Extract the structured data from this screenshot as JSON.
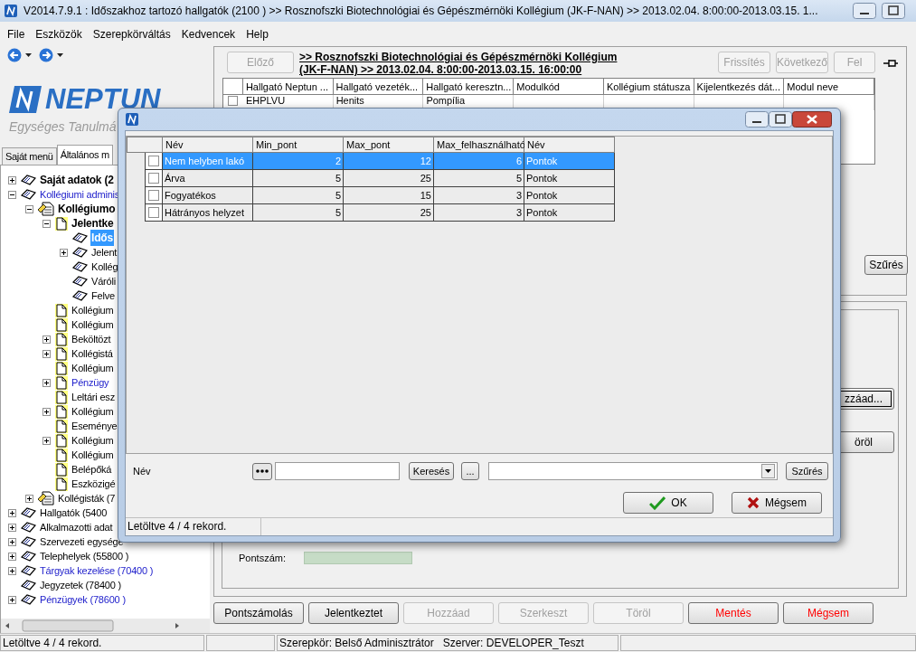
{
  "window": {
    "title": "V2014.7.9.1 : Időszakhoz tartozó hallgatók (2100  ) >> Rosznofszki Biotechnológiai és Gépészmérnöki Kollégium (JK-F-NAN) >> 2013.02.04. 8:00:00-2013.03.15. 1..."
  },
  "menu": [
    "File",
    "Eszközök",
    "Szerepkörváltás",
    "Kedvencek",
    "Help"
  ],
  "logo": {
    "name": "NEPTUN",
    "tagline": "Egységes Tanulmá"
  },
  "sidebar_tabs": [
    {
      "label": "Saját menü",
      "selected": false
    },
    {
      "label": "Általános m",
      "selected": true
    }
  ],
  "tree": [
    {
      "label": "Saját adatok (2",
      "kind": "book",
      "bold": true,
      "linked": false,
      "expanded": false,
      "selected": false
    },
    {
      "label": "Kollégiumi adminis",
      "kind": "book",
      "bold": false,
      "linked": true,
      "expanded": true,
      "selected": false,
      "children": [
        {
          "label": "Kollégiumo",
          "kind": "module",
          "bold": true,
          "linked": false,
          "expanded": true,
          "selected": false,
          "children": [
            {
              "label": "Jelentke",
              "kind": "page",
              "bold": true,
              "linked": false,
              "expanded": true,
              "selected": false,
              "children": [
                {
                  "label": "Idős",
                  "kind": "book",
                  "bold": true,
                  "linked": false,
                  "selected": true
                },
                {
                  "label": "Jelent",
                  "kind": "book",
                  "bold": false,
                  "linked": false,
                  "expanded": false,
                  "selected": false
                },
                {
                  "label": "Kollég",
                  "kind": "book",
                  "bold": false,
                  "linked": false,
                  "selected": false
                },
                {
                  "label": "Váróli",
                  "kind": "book",
                  "bold": false,
                  "linked": false,
                  "selected": false
                },
                {
                  "label": "Felve",
                  "kind": "book",
                  "bold": false,
                  "linked": false,
                  "selected": false
                }
              ]
            },
            {
              "label": "Kollégium",
              "kind": "page",
              "bold": false,
              "linked": false,
              "selected": false
            },
            {
              "label": "Kollégium",
              "kind": "page",
              "bold": false,
              "linked": false,
              "selected": false
            },
            {
              "label": "Beköltözt",
              "kind": "page",
              "bold": false,
              "linked": false,
              "expanded": false,
              "selected": false
            },
            {
              "label": "Kollégistá",
              "kind": "page",
              "bold": false,
              "linked": false,
              "expanded": false,
              "selected": false
            },
            {
              "label": "Kollégium",
              "kind": "page",
              "bold": false,
              "linked": false,
              "selected": false
            },
            {
              "label": "Pénzügy",
              "kind": "page",
              "bold": false,
              "linked": true,
              "expanded": false,
              "selected": false
            },
            {
              "label": "Leltári esz",
              "kind": "page",
              "bold": false,
              "linked": false,
              "selected": false
            },
            {
              "label": "Kollégium",
              "kind": "page",
              "bold": false,
              "linked": false,
              "expanded": false,
              "selected": false
            },
            {
              "label": "Eseménye",
              "kind": "page",
              "bold": false,
              "linked": false,
              "selected": false
            },
            {
              "label": "Kollégium",
              "kind": "page",
              "bold": false,
              "linked": false,
              "expanded": false,
              "selected": false
            },
            {
              "label": "Kollégium",
              "kind": "page",
              "bold": false,
              "linked": false,
              "selected": false
            },
            {
              "label": "Belépőká",
              "kind": "page",
              "bold": false,
              "linked": false,
              "selected": false
            },
            {
              "label": "Eszközigé",
              "kind": "page",
              "bold": false,
              "linked": false,
              "selected": false
            }
          ]
        },
        {
          "label": "Kollégisták (7",
          "kind": "module",
          "bold": false,
          "linked": false,
          "expanded": false,
          "selected": false
        }
      ]
    },
    {
      "label": "Hallgatók (5400",
      "kind": "book",
      "bold": false,
      "linked": false,
      "expanded": false,
      "selected": false
    },
    {
      "label": "Alkalmazotti adat",
      "kind": "book",
      "bold": false,
      "linked": false,
      "expanded": false,
      "selected": false
    },
    {
      "label": "Szervezeti egysége",
      "kind": "book",
      "bold": false,
      "linked": false,
      "expanded": false,
      "selected": false
    },
    {
      "label": "Telephelyek (55800  )",
      "kind": "book",
      "bold": false,
      "linked": false,
      "expanded": false,
      "selected": false
    },
    {
      "label": "Tárgyak kezelése (70400  )",
      "kind": "book",
      "bold": false,
      "linked": true,
      "expanded": false,
      "selected": false
    },
    {
      "label": "Jegyzetek (78400  )",
      "kind": "book",
      "bold": false,
      "linked": false,
      "selected": false
    },
    {
      "label": "Pénzügyek (78600  )",
      "kind": "book",
      "bold": false,
      "linked": true,
      "expanded": false,
      "selected": false
    }
  ],
  "record_header": {
    "previous": {
      "label": "Előző",
      "disabled": true
    },
    "title_lines": [
      ">> Rosznofszki Biotechnológiai és Gépészmérnöki Kollégium",
      "(JK-F-NAN) >> 2013.02.04.  8:00:00-2013.03.15.  16:00:00"
    ],
    "buttons": [
      {
        "label": "Frissítés",
        "disabled": true
      },
      {
        "label": "Következő",
        "disabled": true
      },
      {
        "label": "Fel",
        "disabled": true
      }
    ]
  },
  "students_table": {
    "columns": [
      "Hallgató Neptun ...",
      "Hallgató vezeték...",
      "Hallgató keresztn...",
      "Modulkód",
      "Kollégium státusza",
      "Kijelentkezés dát...",
      "Modul neve"
    ],
    "rows": [
      {
        "checked": false,
        "cells": [
          "EHPLVU",
          "Henits",
          "Pompília"
        ]
      }
    ]
  },
  "filter_button": "Szűrés",
  "side_buttons": [
    "zzáad...",
    "öröl"
  ],
  "score": {
    "label": "Pontszám:"
  },
  "action_buttons": [
    {
      "label": "Pontszámolás",
      "disabled": false,
      "kind": "normal"
    },
    {
      "label": "Jelentkeztet",
      "disabled": false,
      "kind": "normal"
    },
    {
      "label": "Hozzáad",
      "disabled": true,
      "kind": "normal"
    },
    {
      "label": "Szerkeszt",
      "disabled": true,
      "kind": "normal"
    },
    {
      "label": "Töröl",
      "disabled": true,
      "kind": "normal"
    },
    {
      "label": "Mentés",
      "disabled": false,
      "kind": "danger"
    },
    {
      "label": "Mégsem",
      "disabled": false,
      "kind": "danger"
    }
  ],
  "dialog": {
    "table": {
      "columns": [
        "Név",
        "Min_pont",
        "Max_pont",
        "Max_felhasználható",
        "Név"
      ],
      "rows": [
        {
          "selected": true,
          "checked": false,
          "cells": [
            "Nem helyben lakó",
            "2",
            "12",
            "6",
            "Pontok"
          ]
        },
        {
          "selected": false,
          "checked": false,
          "cells": [
            "Árva",
            "5",
            "25",
            "5",
            "Pontok"
          ]
        },
        {
          "selected": false,
          "checked": false,
          "cells": [
            "Fogyatékos",
            "5",
            "15",
            "3",
            "Pontok"
          ]
        },
        {
          "selected": false,
          "checked": false,
          "cells": [
            "Hátrányos helyzet",
            "5",
            "25",
            "3",
            "Pontok"
          ]
        }
      ]
    },
    "filter": {
      "label": "Név",
      "search_button": "Keresés",
      "more_button": "...",
      "filter_button": "Szűrés"
    },
    "ok_button": "OK",
    "cancel_button": "Mégsem",
    "status": "Letöltve 4 / 4 rekord."
  },
  "status_bar": {
    "records": "Letöltve 4 / 4 rekord.",
    "role": "Szerepkör: Belső Adminisztrátor",
    "server": "Szerver: DEVELOPER_Teszt"
  }
}
